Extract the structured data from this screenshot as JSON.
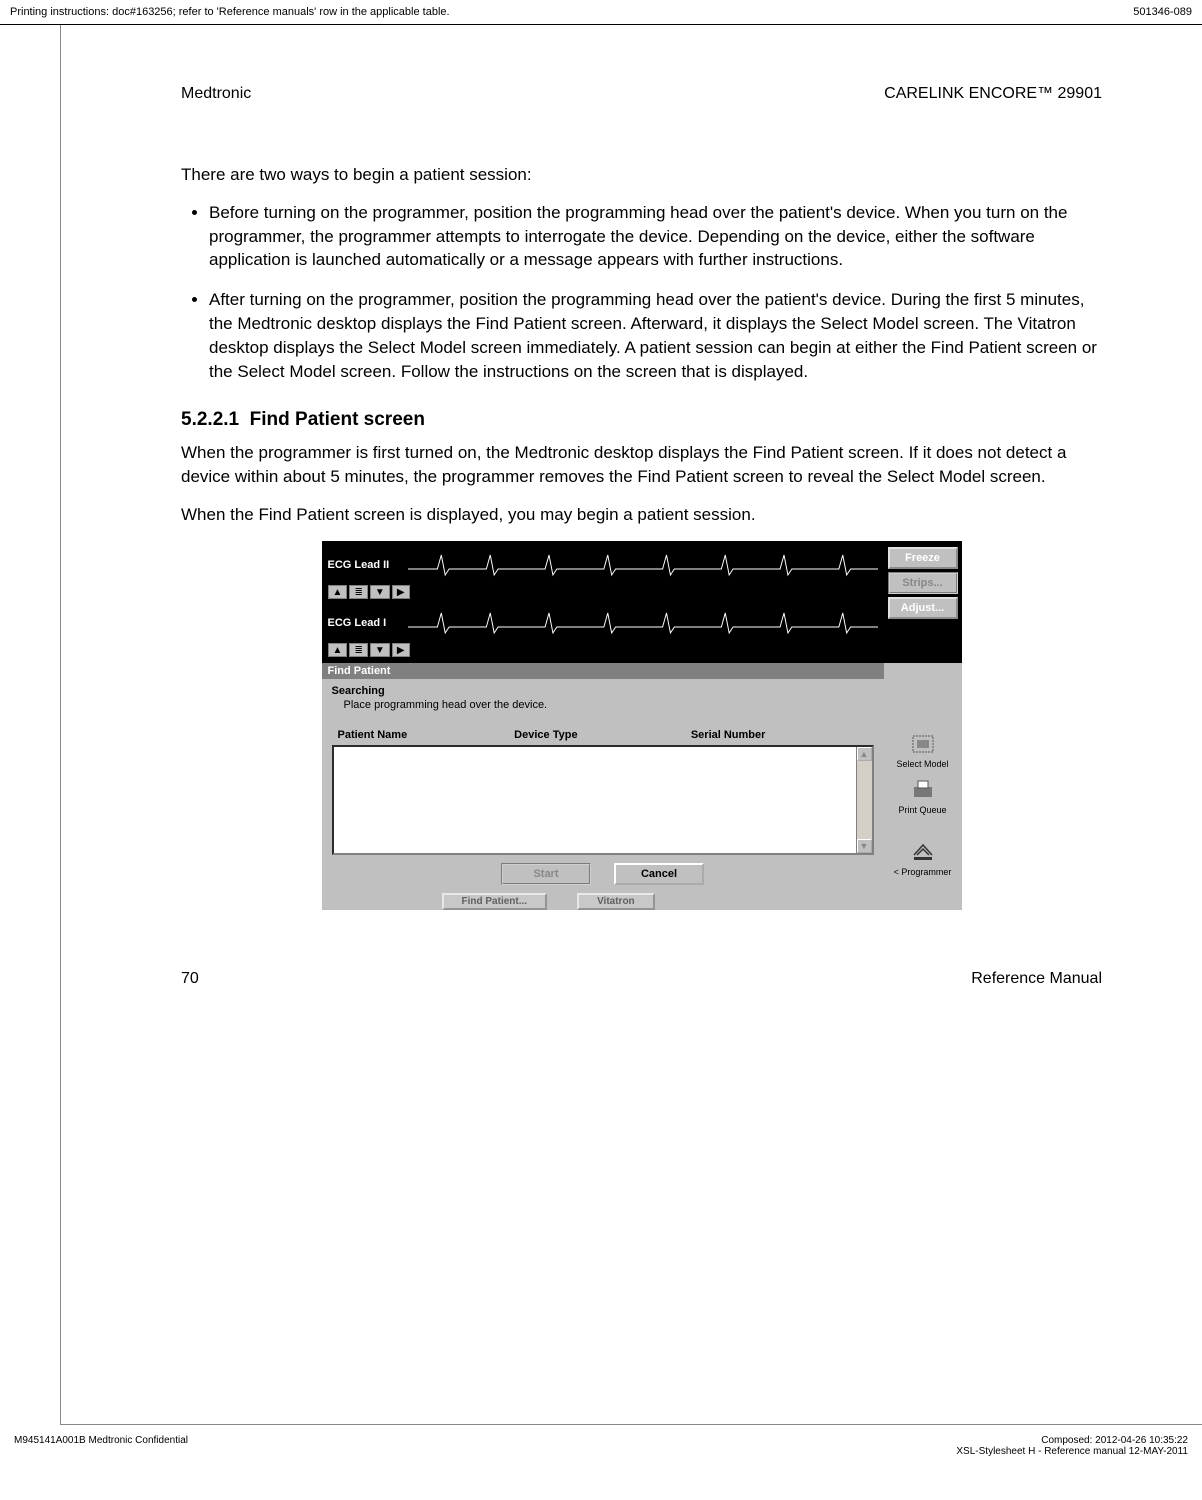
{
  "topbar": {
    "left": "Printing instructions: doc#163256; refer to 'Reference manuals' row in the applicable table.",
    "right": "501346-089"
  },
  "header": {
    "left": "Medtronic",
    "right": "CARELINK ENCORE™ 29901"
  },
  "intro": "There are two ways to begin a patient session:",
  "bullets": [
    "Before turning on the programmer, position the programming head over the patient's device. When you turn on the programmer, the programmer attempts to interrogate the device. Depending on the device, either the software application is launched automatically or a message appears with further instructions.",
    "After turning on the programmer, position the programming head over the patient's device. During the first 5 minutes, the Medtronic desktop displays the Find Patient screen. Afterward, it displays the Select Model screen. The Vitatron desktop displays the Select Model screen immediately. A patient session can begin at either the Find Patient screen or the Select Model screen. Follow the instructions on the screen that is displayed."
  ],
  "section_num": "5.2.2.1",
  "section_title": "Find Patient screen",
  "para1": "When the programmer is first turned on, the Medtronic desktop displays the Find Patient screen. If it does not detect a device within about 5 minutes, the programmer removes the Find Patient screen to reveal the Select Model screen.",
  "para2": "When the Find Patient screen is displayed, you may begin a patient session.",
  "screenshot": {
    "ecg1_label": "ECG Lead II",
    "ecg2_label": "ECG Lead I",
    "ctrl_up": "▲",
    "ctrl_bars": "≣",
    "ctrl_down": "▼",
    "ctrl_right": "▶",
    "side": {
      "freeze": "Freeze",
      "strips": "Strips...",
      "adjust": "Adjust..."
    },
    "dialog": {
      "title": "Find Patient",
      "heading": "Searching",
      "sub": "Place programming head over the device.",
      "cols": {
        "name": "Patient Name",
        "type": "Device Type",
        "serial": "Serial Number"
      },
      "start": "Start",
      "cancel": "Cancel"
    },
    "sideicons": {
      "select_model": "Select Model",
      "print_queue": "Print Queue",
      "programmer": "< Programmer"
    },
    "tabs": {
      "find": "Find Patient...",
      "vitatron": "Vitatron"
    }
  },
  "page_number": "70",
  "ref_manual": "Reference Manual",
  "footer": {
    "left": "M945141A001B Medtronic Confidential",
    "right1": "Composed: 2012-04-26 10:35:22",
    "right2": "XSL-Stylesheet  H - Reference manual  12-MAY-2011"
  }
}
